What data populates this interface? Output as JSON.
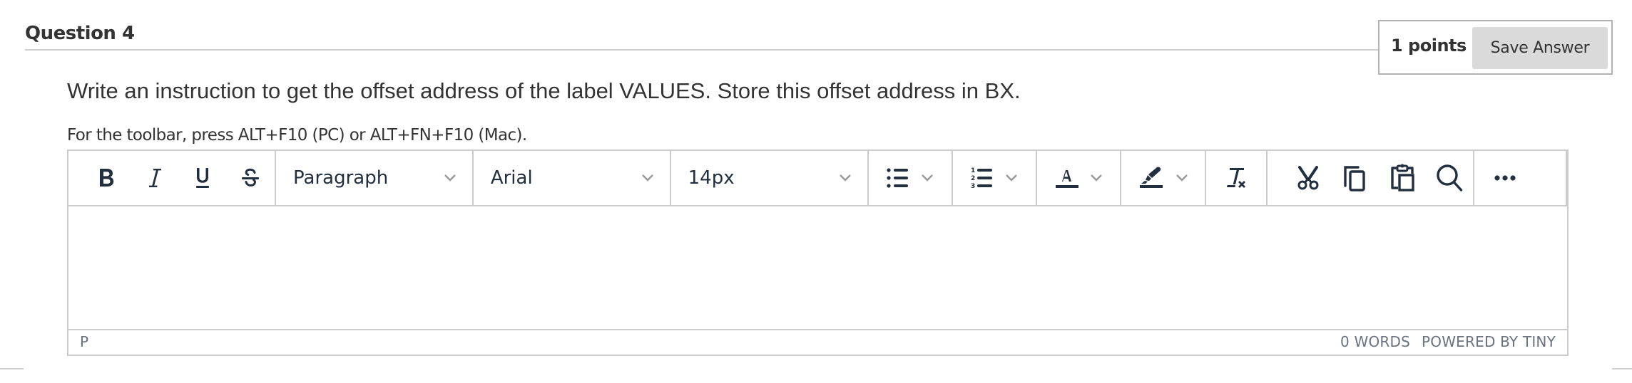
{
  "question": {
    "title": "Question 4",
    "text": "Write an instruction to get the offset address of the label VALUES. Store this offset address in BX.",
    "points_label": "1 points",
    "save_label": "Save Answer"
  },
  "editor": {
    "hint": "For the toolbar, press ALT+F10 (PC) or ALT+FN+F10 (Mac).",
    "toolbar": {
      "block_format": "Paragraph",
      "font_family": "Arial",
      "font_size": "14px",
      "icons": [
        "bold-icon",
        "italic-icon",
        "underline-icon",
        "strikethrough-icon",
        "bullet-list-icon",
        "numbered-list-icon",
        "text-color-icon",
        "highlight-color-icon",
        "clear-formatting-icon",
        "cut-icon",
        "copy-icon",
        "paste-icon",
        "search-icon",
        "more-icon"
      ]
    },
    "content": "",
    "status": {
      "path": "P",
      "word_count": "0 WORDS",
      "branding": "POWERED BY TINY"
    }
  },
  "colors": {
    "icon": "#222f3e",
    "border": "#cccccc",
    "button_bg": "#dadada",
    "status_text": "#6b7280"
  }
}
